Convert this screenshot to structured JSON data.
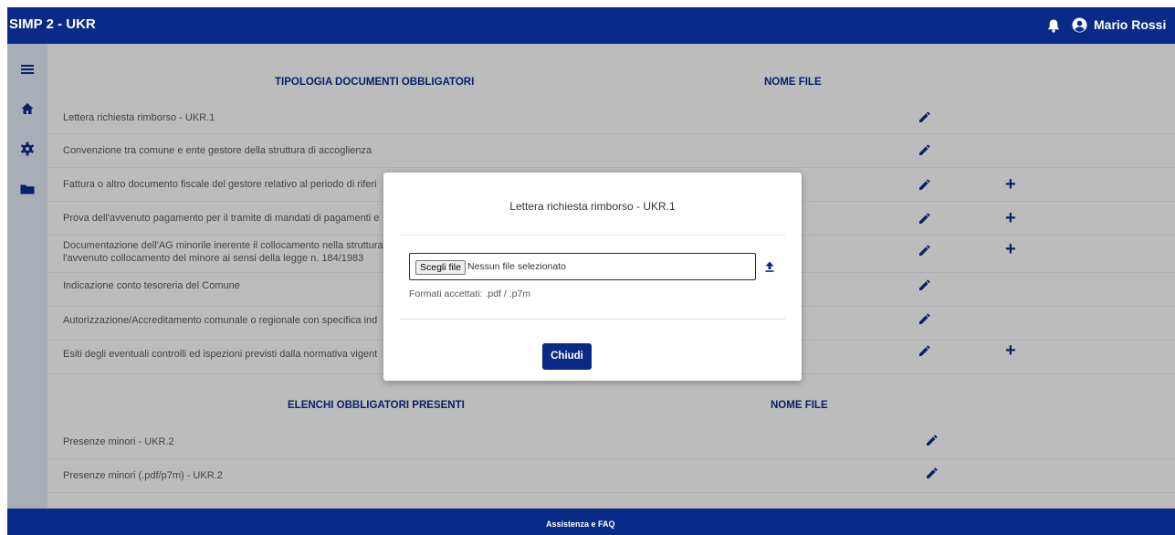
{
  "app": {
    "title": "SIMP 2 - UKR",
    "user_name": "Mario Rossi"
  },
  "table1": {
    "header_type": "TIPOLOGIA DOCUMENTI OBBLIGATORI",
    "header_file": "NOME FILE",
    "rows": [
      {
        "label": "Lettera richiesta rimborso - UKR.1",
        "label2": "",
        "has_add": false
      },
      {
        "label": "Convenzione tra comune e ente gestore della struttura di accoglienza",
        "label2": "",
        "has_add": false
      },
      {
        "label": "Fattura o altro documento fiscale del gestore relativo al periodo di riferi",
        "label2": "",
        "has_add": true
      },
      {
        "label": "Prova dell'avvenuto pagamento per il tramite di mandati di pagamenti e",
        "label2": "",
        "has_add": true
      },
      {
        "label": "Documentazione dell'AG minorile inerente il collocamento nella struttura",
        "label2": "l'avvenuto collocamento del minore ai sensi della legge n. 184/1983",
        "has_add": true
      },
      {
        "label": "Indicazione conto tesoreria del Comune",
        "label2": "",
        "has_add": false
      },
      {
        "label": "Autorizzazione/Accreditamento comunale o regionale con specifica ind",
        "label2": "",
        "has_add": false
      },
      {
        "label": "Esiti degli eventuali controlli ed ispezioni previsti dalla normativa vigent",
        "label2": "",
        "has_add": true
      }
    ]
  },
  "table2": {
    "header_type": "ELENCHI OBBLIGATORI PRESENTI",
    "header_file": "NOME FILE",
    "rows": [
      {
        "label": "Presenze minori - UKR.2"
      },
      {
        "label": "Presenze minori (.pdf/p7m) - UKR.2"
      }
    ]
  },
  "icons": {
    "add": "+"
  },
  "modal": {
    "title": "Lettera richiesta rimborso - UKR.1",
    "choose_button": "Scegli file",
    "no_file": "Nessun file selezionato",
    "formats": "Formati accettati: .pdf / .p7m",
    "close_button": "Chiudi"
  },
  "footer": {
    "link": "Assistenza e FAQ"
  },
  "colors": {
    "primary": "#0a2a87",
    "sidebar": "#d8dfe9",
    "content_bg": "#f1f1f1"
  }
}
